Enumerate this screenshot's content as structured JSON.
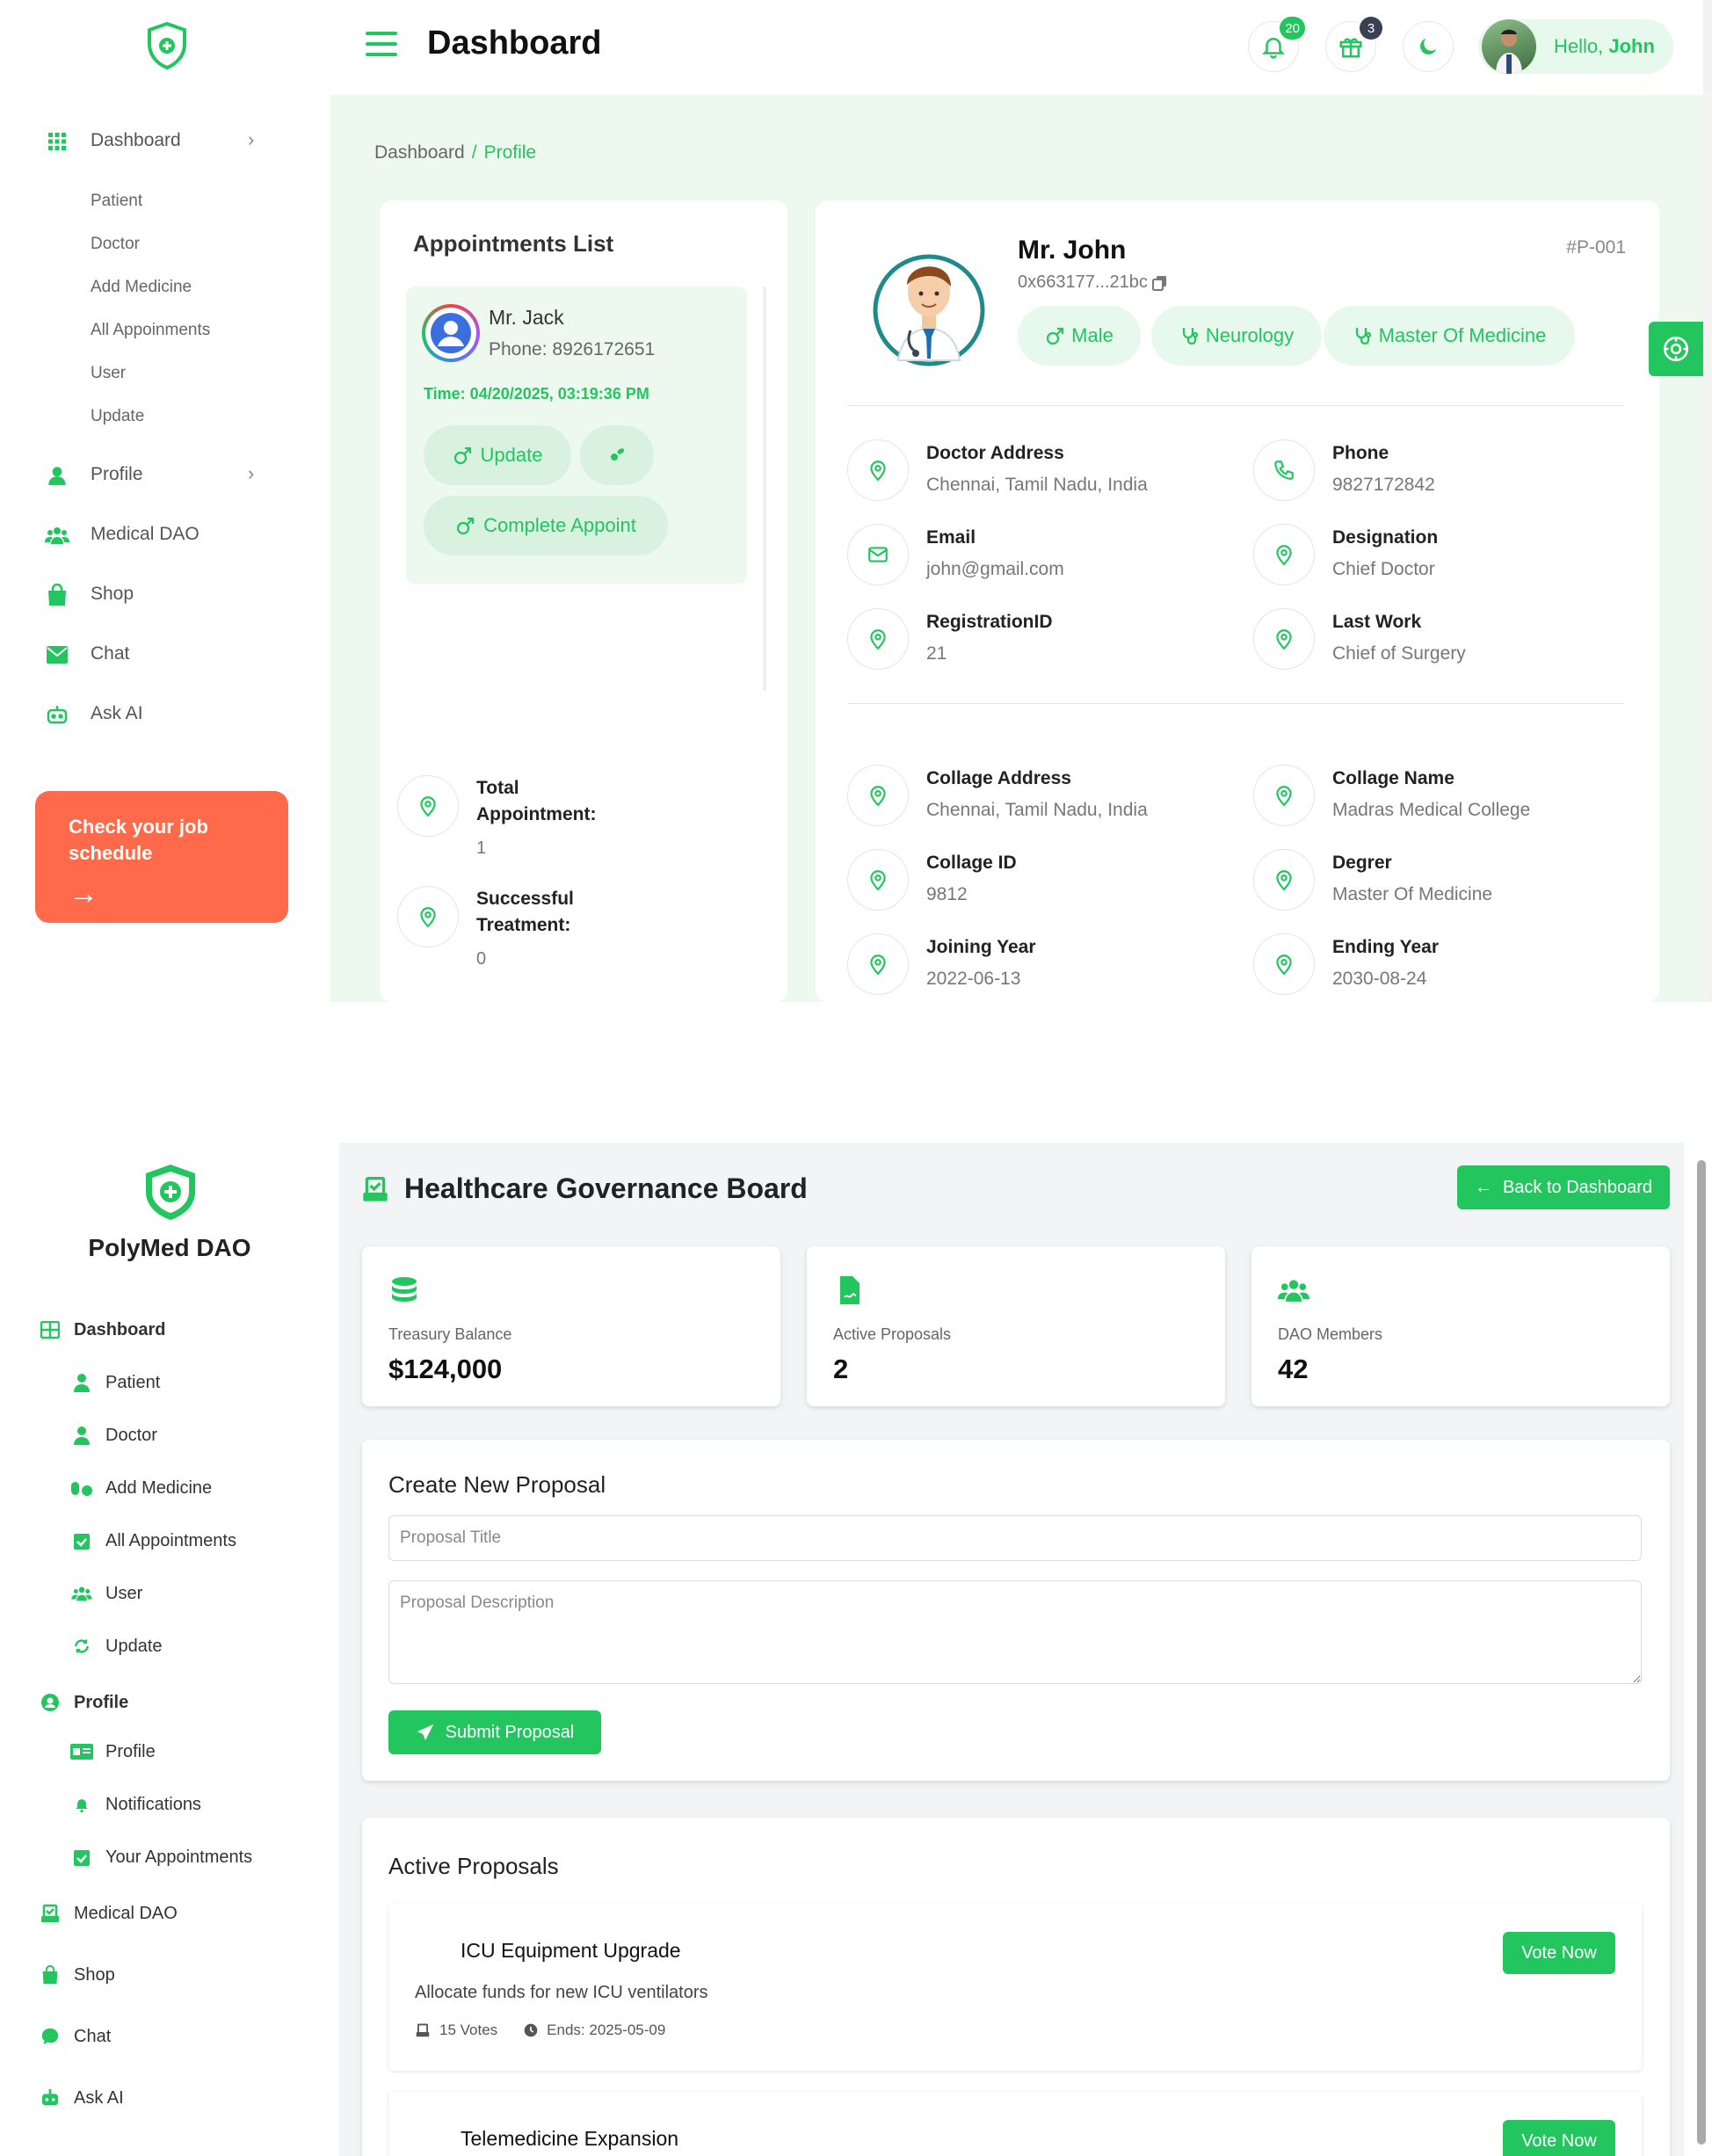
{
  "screen1": {
    "header": {
      "title": "Dashboard",
      "notif_count": "20",
      "gift_count": "3",
      "greeting": "Hello,",
      "user_name": "John"
    },
    "sidebar": {
      "dashboard": "Dashboard",
      "sub_items": [
        "Patient",
        "Doctor",
        "Add Medicine",
        "All Appoinments",
        "User",
        "Update"
      ],
      "profile": "Profile",
      "medical_dao": "Medical DAO",
      "shop": "Shop",
      "chat": "Chat",
      "ask_ai": "Ask AI",
      "job_card": {
        "line1": "Check your job",
        "line2": "schedule",
        "arrow": "→"
      }
    },
    "breadcrumb": {
      "root": "Dashboard",
      "sep": "/",
      "current": "Profile"
    },
    "appointments": {
      "title": "Appointments List",
      "patient_name": "Mr. Jack",
      "patient_phone": "Phone: 8926172651",
      "time": "Time: 04/20/2025, 03:19:36 PM",
      "update_label": "Update",
      "complete_label": "Complete Appoint",
      "stats": [
        {
          "label_1": "Total",
          "label_2": "Appointment:",
          "value": "1"
        },
        {
          "label_1": "Successful",
          "label_2": "Treatment:",
          "value": "0"
        }
      ]
    },
    "doctor": {
      "name": "Mr. John",
      "address": "0x663177...21bc",
      "id": "#P-001",
      "tags": [
        "Male",
        "Neurology",
        "Master Of Medicine"
      ],
      "info_a": [
        {
          "label": "Doctor Address",
          "value": "Chennai, Tamil Nadu, India",
          "icon": "location-icon"
        },
        {
          "label": "Phone",
          "value": "9827172842",
          "icon": "phone-icon"
        },
        {
          "label": "Email",
          "value": "john@gmail.com",
          "icon": "mail-icon"
        },
        {
          "label": "Designation",
          "value": "Chief Doctor",
          "icon": "location-icon"
        },
        {
          "label": "RegistrationID",
          "value": "21",
          "icon": "location-icon"
        },
        {
          "label": "Last Work",
          "value": "Chief of Surgery",
          "icon": "location-icon"
        }
      ],
      "info_b": [
        {
          "label": "Collage Address",
          "value": "Chennai, Tamil Nadu, India"
        },
        {
          "label": "Collage Name",
          "value": "Madras Medical College"
        },
        {
          "label": "Collage ID",
          "value": "9812"
        },
        {
          "label": "Degrer",
          "value": "Master Of Medicine"
        },
        {
          "label": "Joining Year",
          "value": "2022-06-13"
        },
        {
          "label": "Ending Year",
          "value": "2030-08-24"
        }
      ]
    }
  },
  "screen2": {
    "brand": "PolyMed DAO",
    "nav": {
      "dashboard": "Dashboard",
      "patient": "Patient",
      "doctor": "Doctor",
      "add_medicine": "Add Medicine",
      "all_appointments": "All Appointments",
      "user": "User",
      "update": "Update",
      "profile_group": "Profile",
      "profile": "Profile",
      "notifications": "Notifications",
      "your_appointments": "Your Appointments",
      "medical_dao": "Medical DAO",
      "shop": "Shop",
      "chat": "Chat",
      "ask_ai": "Ask AI"
    },
    "title": "Healthcare Governance Board",
    "back_label": "Back to Dashboard",
    "stats": [
      {
        "label": "Treasury Balance",
        "value": "$124,000"
      },
      {
        "label": "Active Proposals",
        "value": "2"
      },
      {
        "label": "DAO Members",
        "value": "42"
      }
    ],
    "create": {
      "title": "Create New Proposal",
      "title_placeholder": "Proposal Title",
      "desc_placeholder": "Proposal Description",
      "submit_label": "Submit Proposal"
    },
    "active": {
      "title": "Active Proposals",
      "proposals": [
        {
          "title": "ICU Equipment Upgrade",
          "desc": "Allocate funds for new ICU ventilators",
          "votes": "15 Votes",
          "ends": "Ends: 2025-05-09",
          "vote_label": "Vote Now"
        },
        {
          "title": "Telemedicine Expansion",
          "vote_label": "Vote Now"
        }
      ]
    }
  },
  "colors": {
    "accent": "#22c55e",
    "job_card": "#ff6b4a",
    "badge_notif": "#22c55e",
    "badge_gift": "#374151"
  }
}
